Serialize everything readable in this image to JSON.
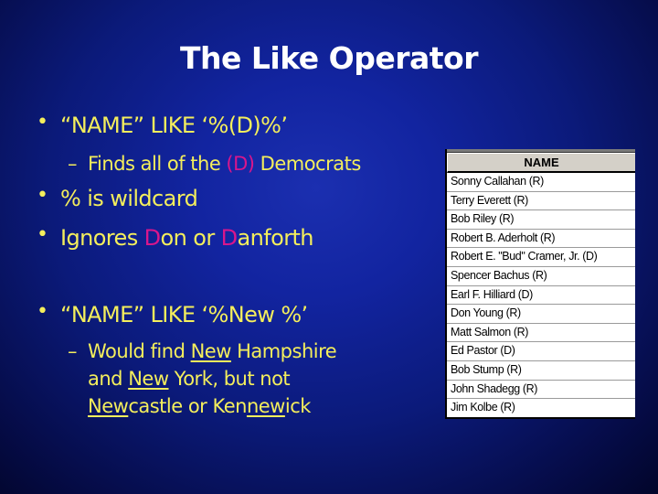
{
  "slide": {
    "title": "The Like Operator",
    "bullets": [
      {
        "text": "“NAME”  LIKE ‘%(D)%’",
        "sub": {
          "prefix": "Finds all of the ",
          "highlight": "(D)",
          "suffix": "  Democrats"
        }
      },
      {
        "text": "% is wildcard"
      },
      {
        "parts": [
          "Ignores ",
          "D",
          "on or ",
          "D",
          "anforth"
        ]
      },
      {
        "text": "“NAME”  LIKE ‘%New %’",
        "sub": {
          "line1": [
            "Would find ",
            "New",
            " Hampshire"
          ],
          "line2": [
            "and ",
            "New",
            " York, but not"
          ],
          "line3": [
            "New",
            "castle or Ken",
            "new",
            "ick"
          ]
        }
      }
    ],
    "bullet_symbol": "•",
    "dash_symbol": "–",
    "highlight_color": "#d9168c",
    "text_color": "#f4ee5c"
  },
  "table": {
    "header": "NAME",
    "rows": [
      "Sonny Callahan (R)",
      "Terry Everett (R)",
      "Bob Riley (R)",
      "Robert B. Aderholt (R)",
      "Robert E. \"Bud\" Cramer, Jr. (D)",
      "Spencer Bachus (R)",
      "Earl F. Hilliard (D)",
      "Don Young (R)",
      "Matt Salmon (R)",
      "Ed Pastor (D)",
      "Bob Stump (R)",
      "John Shadegg (R)",
      "Jim Kolbe (R)"
    ]
  }
}
